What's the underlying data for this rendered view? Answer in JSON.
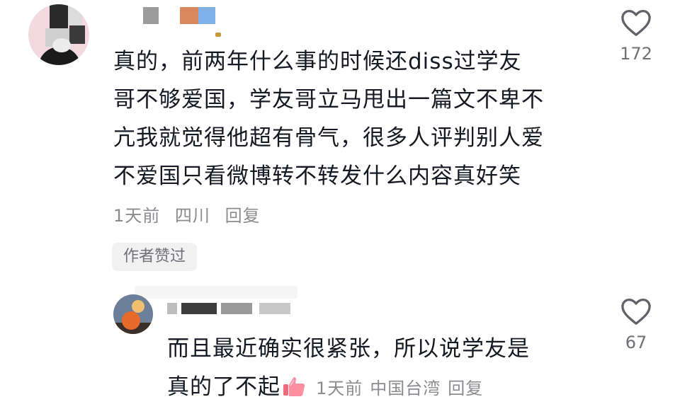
{
  "comment": {
    "text_lines": [
      "真的，前两年什么事的时候还diss过学友",
      "哥不够爱国，学友哥立马甩出一篇文不卑不",
      "亢我就觉得他超有骨气，很多人评判别人爱",
      "不爱国只看微博转不转发什么内容真好笑"
    ],
    "time": "1天前",
    "location": "四川",
    "reply_label": "回复",
    "author_badge": "作者赞过",
    "like_count": "172"
  },
  "reply": {
    "text_line1": "而且最近确实很紧张，所以说学友是",
    "text_line2": "真的了不起",
    "emoji_icon": "thumbs-up-emoji",
    "time": "1天前",
    "location": "中国台湾",
    "reply_label": "回复",
    "like_count": "67"
  },
  "colors": {
    "text": "#161823",
    "meta": "#8a8b91",
    "badge_bg": "#f1f1f2"
  }
}
